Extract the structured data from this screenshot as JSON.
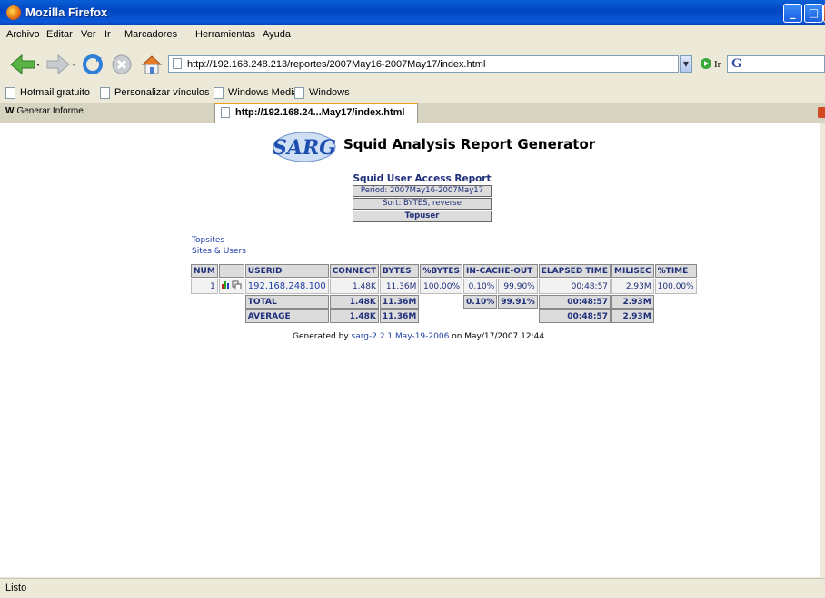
{
  "window": {
    "title": "Mozilla Firefox"
  },
  "menu": [
    "Archivo",
    "Editar",
    "Ver",
    "Ir",
    "Marcadores",
    "Herramientas",
    "Ayuda"
  ],
  "nav": {
    "url": "http://192.168.248.213/reportes/2007May16-2007May17/index.html",
    "go_label": "Ir"
  },
  "bookmarks": [
    "Hotmail gratuito",
    "Personalizar vínculos",
    "Windows Media",
    "Windows"
  ],
  "tabs": {
    "inactive": "Generar Informe",
    "active": "http://192.168.24...May17/index.html"
  },
  "report": {
    "logo_text": "SARG",
    "heading": "Squid Analysis Report Generator",
    "title": "Squid User Access Report",
    "period": "Period: 2007May16-2007May17",
    "sort": "Sort: BYTES, reverse",
    "topuser": "Topuser",
    "links": [
      "Topsites",
      "Sites & Users"
    ],
    "columns": [
      "NUM",
      "",
      "USERID",
      "CONNECT",
      "BYTES",
      "%BYTES",
      "IN-CACHE-OUT",
      "",
      "ELAPSED TIME",
      "MILISEC",
      "%TIME"
    ],
    "row": {
      "num": "1",
      "userid": "192.168.248.100",
      "connect": "1.48K",
      "bytes": "11.36M",
      "pbytes": "100.00%",
      "in": "0.10%",
      "out": "99.90%",
      "elapsed": "00:48:57",
      "milisec": "2.93M",
      "ptime": "100.00%"
    },
    "total": {
      "label": "TOTAL",
      "connect": "1.48K",
      "bytes": "11.36M",
      "in": "0.10%",
      "out": "99.91%",
      "elapsed": "00:48:57",
      "milisec": "2.93M"
    },
    "average": {
      "label": "AVERAGE",
      "connect": "1.48K",
      "bytes": "11.36M",
      "elapsed": "00:48:57",
      "milisec": "2.93M"
    },
    "generated_prefix": "Generated by",
    "generated_link": "sarg-2.2.1 May-19-2006",
    "generated_suffix": "on May/17/2007 12:44"
  },
  "status": "Listo"
}
